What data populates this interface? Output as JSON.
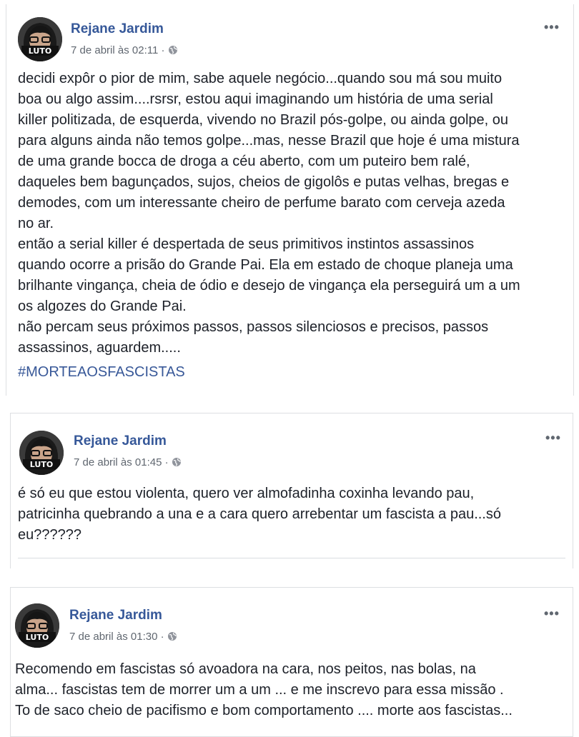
{
  "posts": [
    {
      "author": "Rejane Jardim",
      "timestamp": "7 de abril às 02:11",
      "privacy_icon": "globe-icon",
      "options_icon": "more-options-icon",
      "options_label": "•••",
      "text_lines": [
        "decidi expôr o pior de mim, sabe aquele negócio...quando sou má sou muito",
        "boa ou algo assim....rsrsr, estou aqui imaginando um história de uma serial",
        "killer politizada, de esquerda, vivendo no Brazil pós-golpe, ou ainda golpe, ou",
        "para alguns ainda não temos golpe...mas, nesse Brazil que hoje é uma mistura",
        "de uma grande bocca de droga a céu aberto, com um puteiro bem ralé,",
        "daqueles bem bagunçados, sujos, cheios de gigolôs e putas velhas, bregas e",
        "demodes, com um interessante cheiro de perfume barato com cerveja azeda",
        "no ar.",
        "então a serial killer é despertada de seus primitivos instintos assassinos",
        "quando ocorre a prisão do Grande Pai. Ela em estado de choque planeja uma",
        "brilhante vingança, cheia de ódio e desejo de vingança ela perseguirá um a um",
        "os algozes do Grande Pai.",
        "não percam seus próximos passos, passos silenciosos e precisos, passos",
        "assassinos, aguardem....."
      ],
      "hashtag": "#MORTEAOSFASCISTAS"
    },
    {
      "author": "Rejane Jardim",
      "timestamp": "7 de abril às 01:45",
      "privacy_icon": "globe-icon",
      "options_icon": "more-options-icon",
      "options_label": "•••",
      "text_lines": [
        "é só eu que estou violenta, quero ver almofadinha coxinha levando pau,",
        "patricinha quebrando a una e a cara quero arrebentar um fascista a pau...só",
        "eu??????"
      ]
    },
    {
      "author": "Rejane Jardim",
      "timestamp": "7 de abril às 01:30",
      "privacy_icon": "globe-icon",
      "options_icon": "more-options-icon",
      "options_label": "•••",
      "text_lines": [
        "Recomendo em fascistas só avoadora na cara, nos peitos, nas bolas, na",
        "alma... fascistas tem de morrer um a um ... e me inscrevo para essa missão .",
        "To de saco cheio de pacifismo e bom comportamento .... morte aos fascistas..."
      ]
    }
  ],
  "avatar_badge": "LUTO",
  "colors": {
    "author": "#365899",
    "meta": "#606770",
    "text": "#1d2129",
    "hashtag": "#385898",
    "border": "#dddfe2"
  }
}
